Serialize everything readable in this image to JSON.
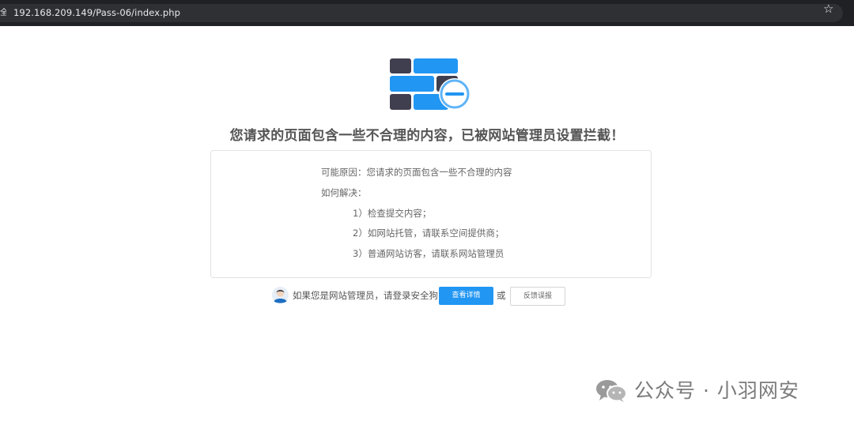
{
  "browser": {
    "lock_glyph": "全",
    "url": "192.168.209.149/Pass-06/index.php",
    "bookmark_icon": "star-icon"
  },
  "block_page": {
    "title": "您请求的页面包含一些不合理的内容，已被网站管理员设置拦截！",
    "reason": "可能原因：您请求的页面包含一些不合理的内容",
    "how_to_resolve": "如何解决：",
    "steps": [
      "1）检查提交内容；",
      "2）如网站托管，请联系空间提供商；",
      "3）普通网站访客，请联系网站管理员"
    ]
  },
  "footer": {
    "admin_prompt": "如果您是网站管理员，请登录安全狗",
    "details_button": "查看详情",
    "or": "或",
    "report_button": "反馈误报"
  },
  "watermark": {
    "text": "公众号 · 小羽网安",
    "icon": "wechat-icon"
  },
  "colors": {
    "accent_blue": "#2196f3",
    "brick_dark": "#3f3f4f",
    "title_gray": "#555555"
  }
}
